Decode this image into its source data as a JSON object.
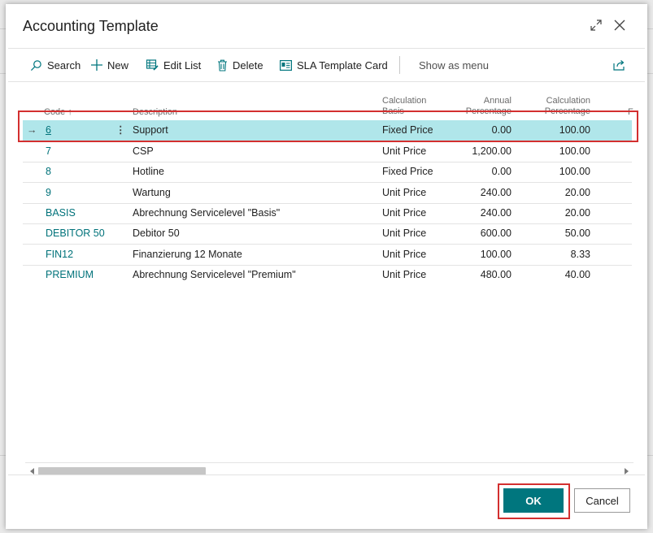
{
  "dialog": {
    "title": "Accounting Template"
  },
  "toolbar": {
    "search": "Search",
    "new": "New",
    "edit_list": "Edit List",
    "delete": "Delete",
    "sla_card": "SLA Template Card",
    "show_as_menu": "Show as menu"
  },
  "columns": {
    "code": "Code",
    "description": "Description",
    "calc_basis_1": "Calculation",
    "calc_basis_2": "Basis",
    "annual_1": "Annual",
    "annual_2": "Percentage",
    "calc_pct_1": "Calculation",
    "calc_pct_2": "Percentage",
    "extra": "F"
  },
  "rows": [
    {
      "code": "6",
      "description": "Support",
      "basis": "Fixed Price",
      "annual": "0.00",
      "pct": "100.00"
    },
    {
      "code": "7",
      "description": "CSP",
      "basis": "Unit Price",
      "annual": "1,200.00",
      "pct": "100.00"
    },
    {
      "code": "8",
      "description": "Hotline",
      "basis": "Fixed Price",
      "annual": "0.00",
      "pct": "100.00"
    },
    {
      "code": "9",
      "description": "Wartung",
      "basis": "Unit Price",
      "annual": "240.00",
      "pct": "20.00"
    },
    {
      "code": "BASIS",
      "description": "Abrechnung Servicelevel \"Basis\"",
      "basis": "Unit Price",
      "annual": "240.00",
      "pct": "20.00"
    },
    {
      "code": "DEBITOR 50",
      "description": "Debitor 50",
      "basis": "Unit Price",
      "annual": "600.00",
      "pct": "50.00"
    },
    {
      "code": "FIN12",
      "description": "Finanzierung 12 Monate",
      "basis": "Unit Price",
      "annual": "100.00",
      "pct": "8.33"
    },
    {
      "code": "PREMIUM",
      "description": "Abrechnung Servicelevel \"Premium\"",
      "basis": "Unit Price",
      "annual": "480.00",
      "pct": "40.00"
    }
  ],
  "buttons": {
    "ok": "OK",
    "cancel": "Cancel"
  },
  "colors": {
    "accent": "#00767e",
    "selected_row": "#b0e6ea",
    "highlight": "#d32f2f",
    "link": "#00727a"
  }
}
